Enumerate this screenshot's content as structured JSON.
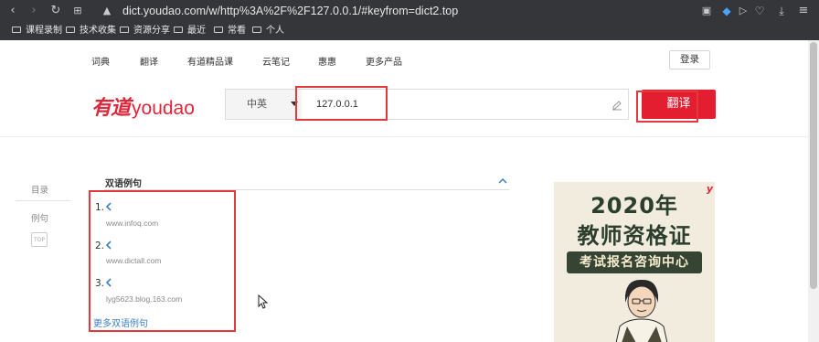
{
  "browser": {
    "url": "dict.youdao.com/w/http%3A%2F%2F127.0.0.1/#keyfrom=dict2.top",
    "bookmarks": [
      "课程录制",
      "技术收集",
      "资源分享",
      "最近",
      "常看",
      "个人"
    ],
    "icons": [
      "back-icon",
      "forward-icon",
      "reload-icon",
      "apps-icon",
      "warning-icon",
      "camera-icon",
      "shield-icon",
      "send-icon",
      "heart-icon",
      "download-icon",
      "menu-icon"
    ]
  },
  "nav": {
    "items": [
      "词典",
      "翻译",
      "有道精品课",
      "云笔记",
      "惠惠",
      "更多产品"
    ],
    "login": "登录"
  },
  "logo": {
    "cn": "有道",
    "en": "youdao"
  },
  "search": {
    "lang": "中英",
    "query": "127.0.0.1",
    "button": "翻译"
  },
  "sidebar": {
    "items": [
      "目录",
      "例句"
    ],
    "top": "TOP"
  },
  "examples": {
    "title": "双语例句",
    "items": [
      {
        "num": "1.",
        "source": "www.infoq.com"
      },
      {
        "num": "2.",
        "source": "www.dictall.com"
      },
      {
        "num": "3.",
        "source": "lyg5623.blog.163.com"
      }
    ],
    "more": "更多双语例句"
  },
  "ad": {
    "brand": "y",
    "line1": "2020年",
    "line2": "教师资格证",
    "banner": "考试报名咨询中心"
  },
  "colors": {
    "brand_red": "#e31e31",
    "chrome_bg": "#35363a",
    "link_blue": "#3a7fc8",
    "annotation_red": "#e4393c"
  }
}
